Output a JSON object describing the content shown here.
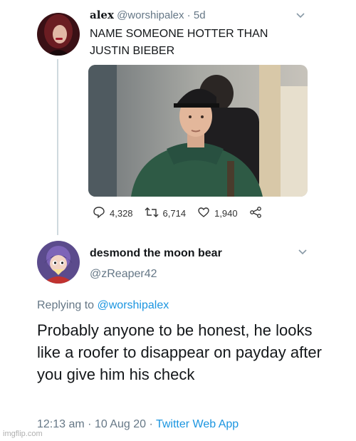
{
  "tweet": {
    "display_name": "alex",
    "handle": "@worshipalex",
    "time_separator": " · ",
    "age": "5d",
    "text": "NAME SOMEONE HOTTER THAN JUSTIN BIEBER",
    "replies": "4,328",
    "retweets": "6,714",
    "likes": "1,940"
  },
  "reply": {
    "display_name": "desmond the moon bear",
    "handle": "@zReaper42",
    "replying_prefix": "Replying to ",
    "replying_to": "@worshipalex",
    "text": "Probably anyone to be honest, he looks like a roofer to disappear on payday after you give him his check",
    "time": "12:13 am",
    "date": "10 Aug 20",
    "meta_separator": " · ",
    "source": "Twitter Web App"
  },
  "watermark": "imgflip.com",
  "colors": {
    "link": "#1b95e0",
    "muted": "#657786",
    "thread_line": "#cfd9de"
  },
  "icons": [
    "reply-icon",
    "retweet-icon",
    "like-icon",
    "share-icon",
    "chevron-down-icon"
  ]
}
